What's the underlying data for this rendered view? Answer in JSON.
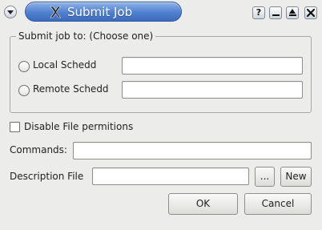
{
  "window": {
    "title": "Submit Job",
    "help_glyph": "?"
  },
  "group": {
    "legend": "Submit job to: (Choose one)",
    "options": [
      {
        "label": "Local Schedd",
        "value": ""
      },
      {
        "label": "Remote Schedd",
        "value": ""
      }
    ]
  },
  "disable_file_permissions": {
    "label": "Disable File permitions",
    "checked": false
  },
  "commands": {
    "label": "Commands:",
    "value": ""
  },
  "description_file": {
    "label": "Description File",
    "value": ""
  },
  "buttons": {
    "browse": "...",
    "new": "New",
    "ok": "OK",
    "cancel": "Cancel"
  },
  "colors": {
    "title_bar": "#4f7fcf",
    "window_bg": "#ececea"
  },
  "icons": {
    "window_menu": "chevron-down-icon",
    "app": "x-logo-icon",
    "help": "help-icon",
    "minimize": "minimize-icon",
    "maximize": "maximize-icon",
    "close": "close-icon"
  }
}
